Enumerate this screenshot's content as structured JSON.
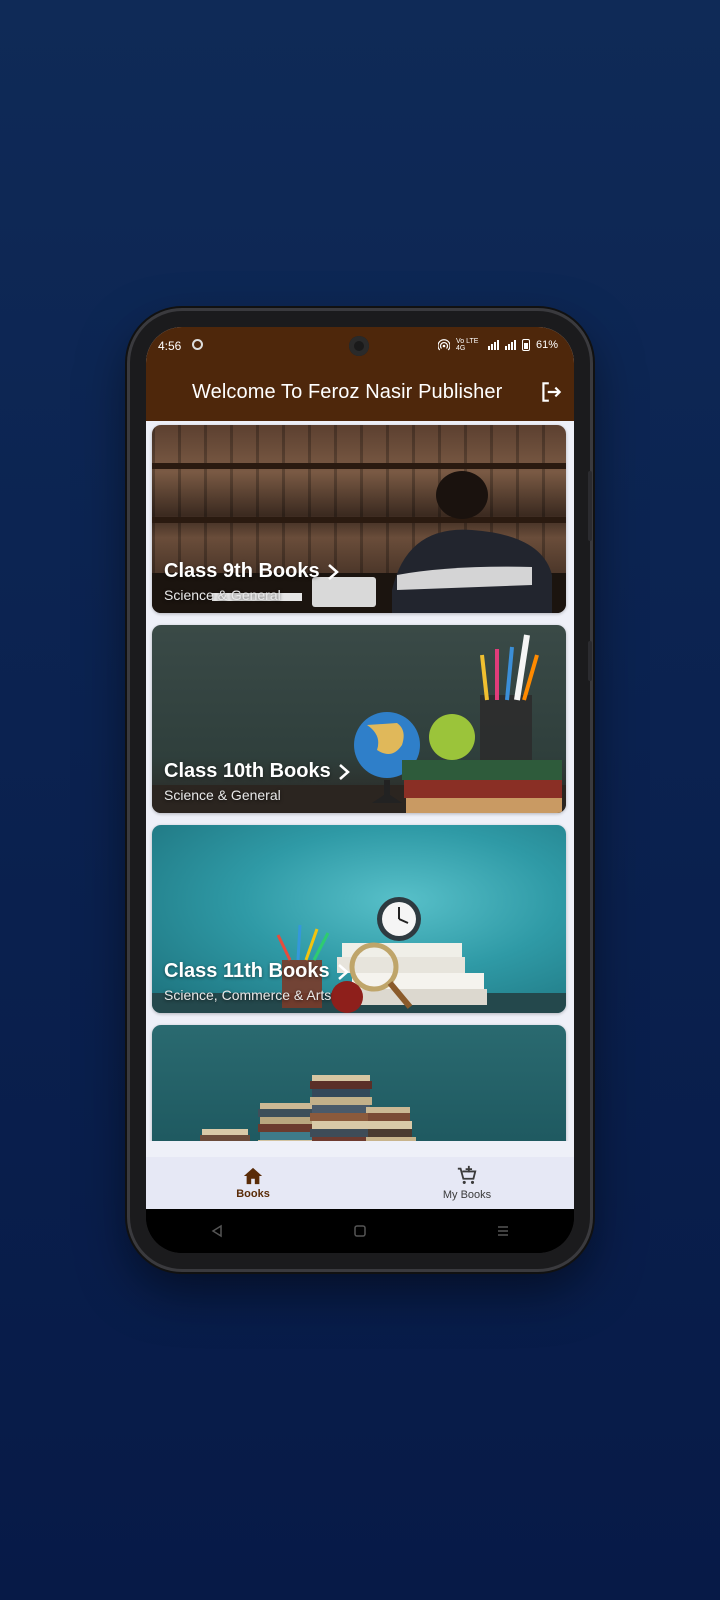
{
  "status": {
    "time": "4:56",
    "network": "Vo LTE 4G",
    "battery": "61%"
  },
  "appbar": {
    "title": "Welcome To Feroz Nasir Publisher",
    "logout_icon": "logout-icon"
  },
  "cards": [
    {
      "title": "Class 9th Books",
      "subtitle": "Science & General"
    },
    {
      "title": "Class 10th Books",
      "subtitle": "Science & General"
    },
    {
      "title": "Class 11th Books",
      "subtitle": "Science, Commerce & Arts"
    },
    {
      "title": "",
      "subtitle": ""
    }
  ],
  "bottom_nav": [
    {
      "label": "Books",
      "icon": "home-icon",
      "active": true
    },
    {
      "label": "My Books",
      "icon": "cart-add-icon",
      "active": false
    }
  ],
  "colors": {
    "brand": "#4e270b",
    "page_bg": "#0b2250",
    "nav_bg": "#e6e8f5"
  }
}
